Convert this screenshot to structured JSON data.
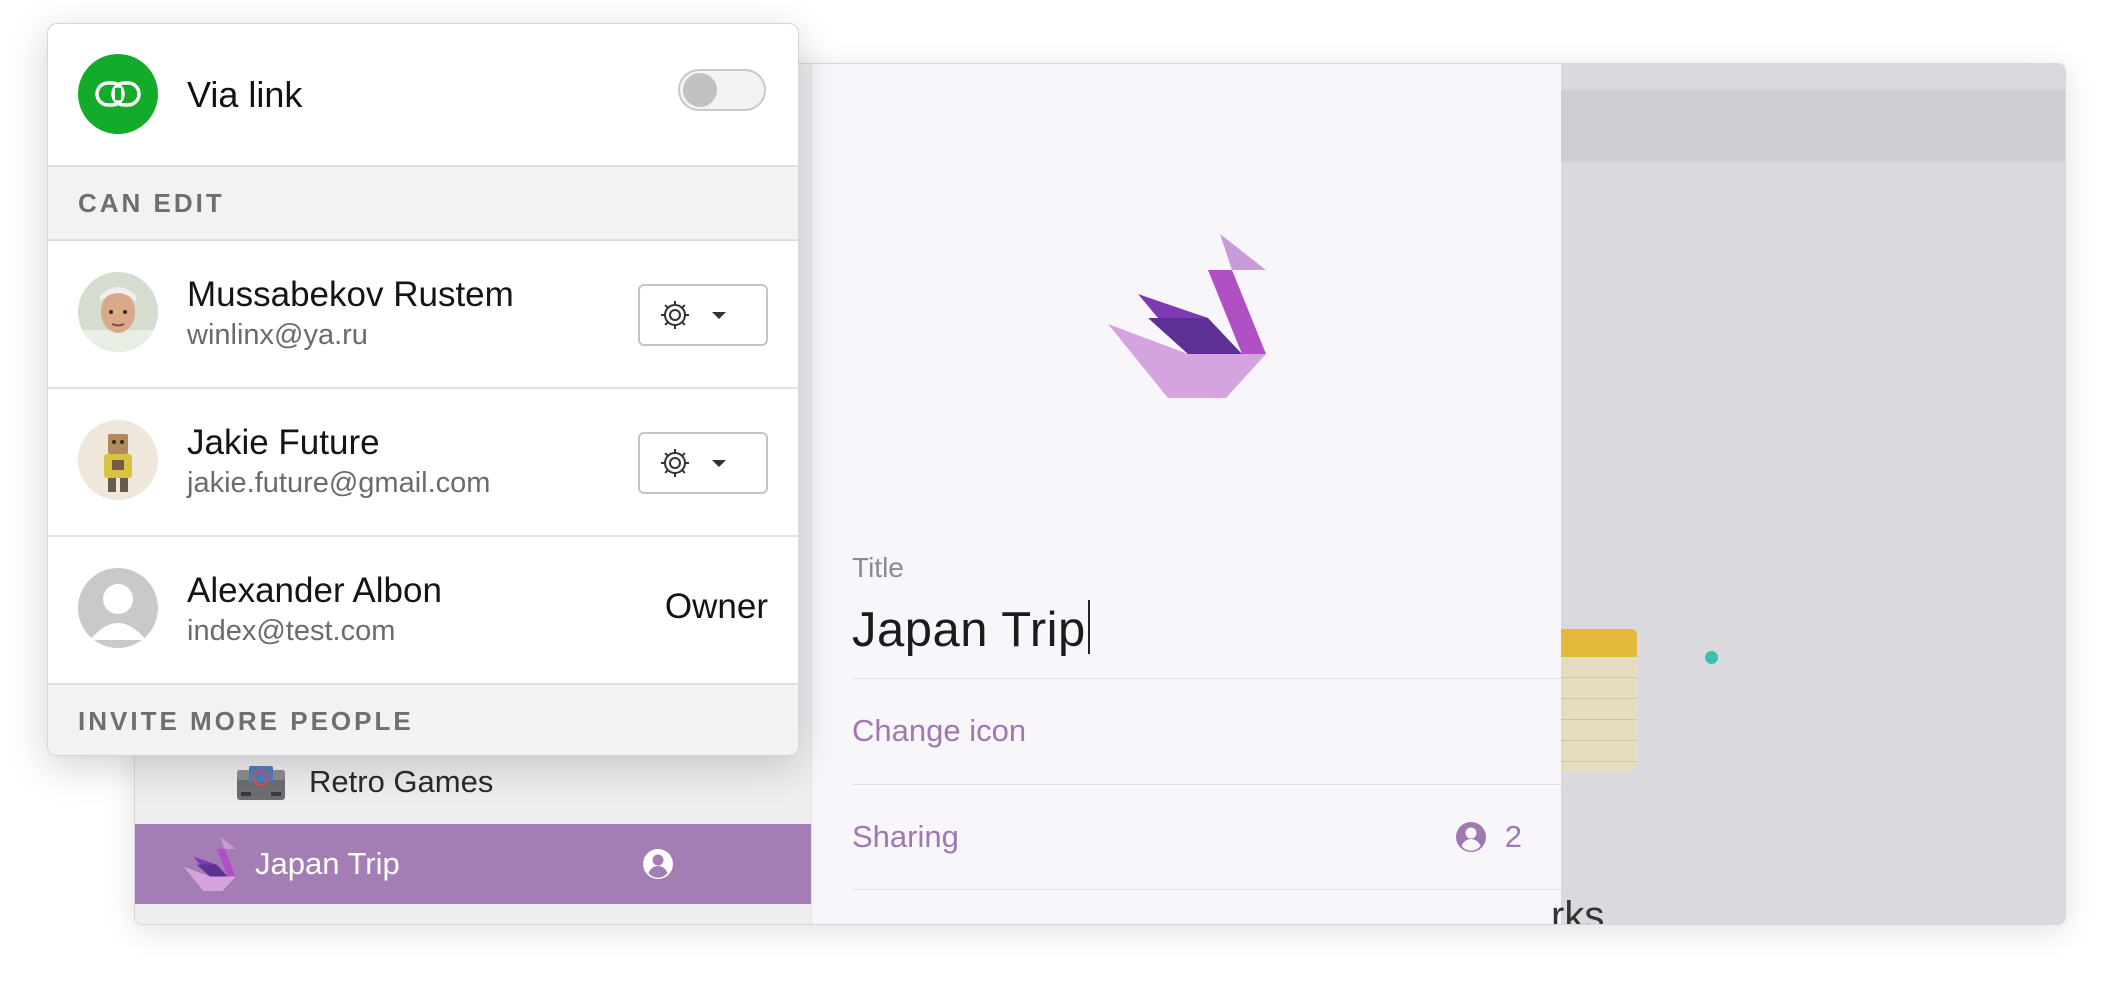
{
  "background_app": {
    "sidebar": {
      "items": [
        {
          "label": "Retro Games",
          "icon": "game-console-icon"
        },
        {
          "label": "Japan Trip",
          "icon": "origami-swan-icon",
          "selected": true,
          "shared_icon": "person-circle-icon"
        }
      ]
    },
    "detail": {
      "icon": "origami-swan-icon",
      "title_label": "Title",
      "title_value": "Japan Trip",
      "change_icon_label": "Change icon",
      "sharing_label": "Sharing",
      "sharing_count": "2"
    },
    "right_pane": {
      "partial_text": "rks"
    }
  },
  "share_popover": {
    "via_link_label": "Via link",
    "via_link_enabled": false,
    "can_edit_header": "CAN EDIT",
    "members": [
      {
        "name": "Mussabekov Rustem",
        "email": "winlinx@ya.ru",
        "role": "editor"
      },
      {
        "name": "Jakie Future",
        "email": "jakie.future@gmail.com",
        "role": "editor"
      },
      {
        "name": "Alexander Albon",
        "email": "index@test.com",
        "role_label": "Owner"
      }
    ],
    "invite_header": "INVITE MORE PEOPLE"
  },
  "colors": {
    "accent_purple": "#a078b0",
    "selected_row": "#a47db4",
    "link_green": "#12ab2a"
  }
}
